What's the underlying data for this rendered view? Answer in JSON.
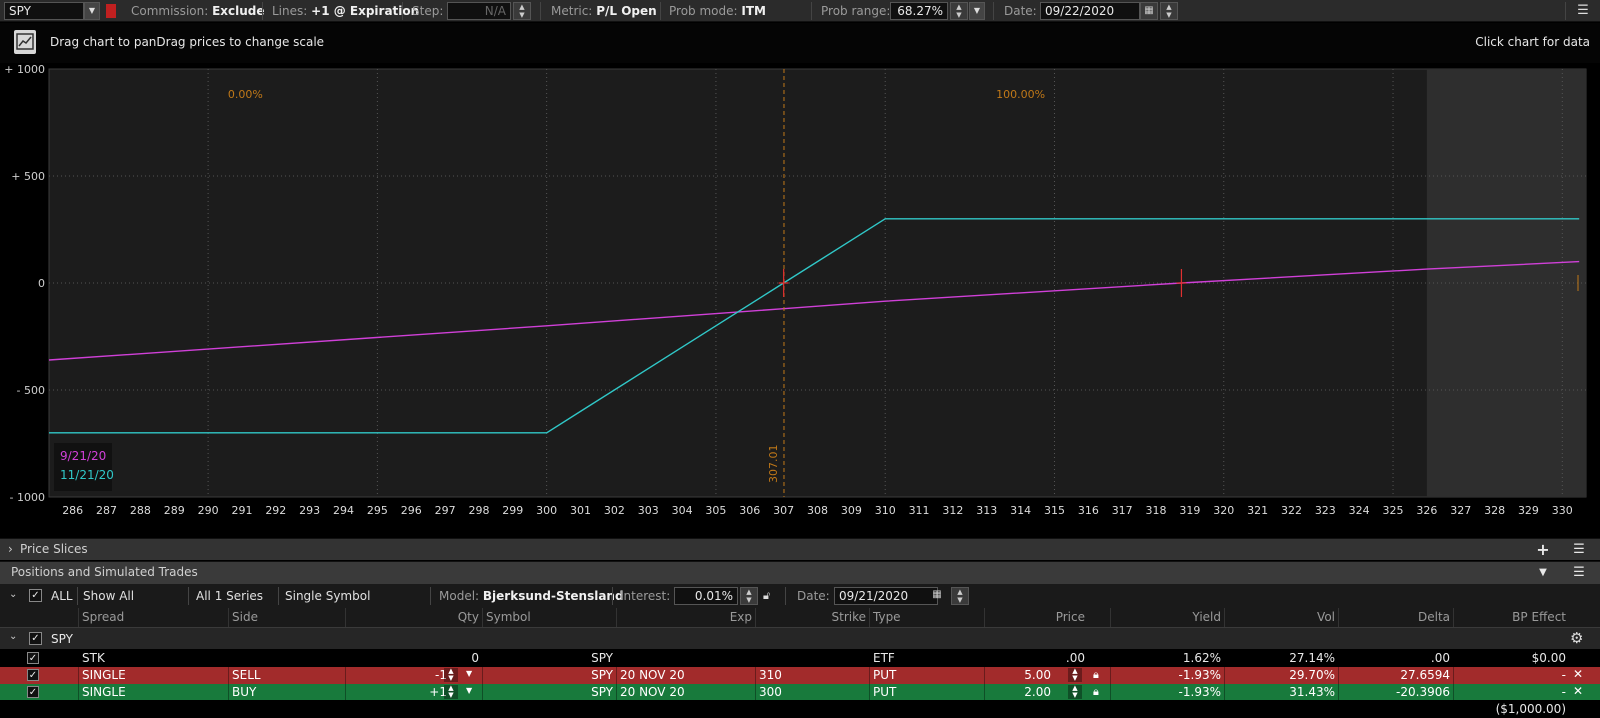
{
  "toolbar": {
    "symbol": "SPY",
    "commission_label": "Commission:",
    "commission_value": "Exclude",
    "lines_label": "Lines:",
    "lines_value": "+1 @ Expiration",
    "step_label": "Step:",
    "step_value": "N/A",
    "metric_label": "Metric:",
    "metric_value": "P/L Open",
    "prob_mode_label": "Prob mode:",
    "prob_mode_value": "ITM",
    "prob_range_label": "Prob range:",
    "prob_range_value": "68.27%",
    "date_label": "Date:",
    "date_value": "09/22/2020"
  },
  "infobar": {
    "hint": "Drag chart to panDrag prices to change scale",
    "click_hint": "Click chart for data"
  },
  "chart_data": {
    "type": "line",
    "x_range": [
      285.3,
      330.7
    ],
    "y_range": [
      -1000,
      1000
    ],
    "y_ticks": [
      {
        "value": 1000,
        "label": "+ 1000"
      },
      {
        "value": 500,
        "label": "+ 500"
      },
      {
        "value": 0,
        "label": "0"
      },
      {
        "value": -500,
        "label": "- 500"
      },
      {
        "value": -1000,
        "label": "- 1000"
      }
    ],
    "x_ticks": [
      286,
      287,
      288,
      289,
      290,
      291,
      292,
      293,
      294,
      295,
      296,
      297,
      298,
      299,
      300,
      301,
      302,
      303,
      304,
      305,
      306,
      307,
      308,
      309,
      310,
      311,
      312,
      313,
      314,
      315,
      316,
      317,
      318,
      319,
      320,
      321,
      322,
      323,
      324,
      325,
      326,
      327,
      328,
      329,
      330
    ],
    "major_x_gridlines": [
      290,
      295,
      300,
      305,
      310,
      315,
      320,
      325,
      330
    ],
    "current_price": 307.01,
    "current_price_label": "307.01",
    "shaded_from_x": 326.0,
    "prob_labels": [
      {
        "x": 291.1,
        "text": "0.00%"
      },
      {
        "x": 314.0,
        "text": "100.00%"
      }
    ],
    "breakeven_markers": [
      {
        "x": 307.0,
        "y": 0
      },
      {
        "x": 318.75,
        "y": 0
      }
    ],
    "series": [
      {
        "name": "9/21/20",
        "color": "#d040d8",
        "points": [
          [
            285.3,
            -360
          ],
          [
            300,
            -200
          ],
          [
            307,
            -120
          ],
          [
            310,
            -85
          ],
          [
            318.75,
            0
          ],
          [
            326,
            65
          ],
          [
            330.5,
            100
          ]
        ]
      },
      {
        "name": "11/21/20",
        "color": "#30c8c8",
        "points": [
          [
            285.3,
            -700
          ],
          [
            300,
            -700
          ],
          [
            301,
            -600
          ],
          [
            305,
            -200
          ],
          [
            307,
            0
          ],
          [
            309,
            200
          ],
          [
            310,
            300
          ],
          [
            330.5,
            300
          ]
        ]
      }
    ]
  },
  "sections": {
    "price_slices": "Price Slices",
    "positions": "Positions and Simulated Trades"
  },
  "filter": {
    "all_label": "ALL",
    "show_all": "Show All",
    "series": "All 1 Series",
    "single_symbol": "Single Symbol",
    "model_label": "Model:",
    "model_value": "Bjerksund-Stensland",
    "interest_label": "Interest:",
    "interest_value": "0.01%",
    "date_label": "Date:",
    "date_value": "09/21/2020"
  },
  "table": {
    "headers": {
      "spread": "Spread",
      "side": "Side",
      "qty": "Qty",
      "symbol": "Symbol",
      "exp": "Exp",
      "strike": "Strike",
      "type": "Type",
      "price": "Price",
      "yield": "Yield",
      "vol": "Vol",
      "delta": "Delta",
      "bp_effect": "BP Effect"
    },
    "group": "SPY",
    "rows": [
      {
        "spread": "STK",
        "side": "",
        "qty": "0",
        "symbol": "SPY",
        "exp": "",
        "strike": "",
        "type": "ETF",
        "price": ".00",
        "yield": "1.62%",
        "vol": "27.14%",
        "delta": ".00",
        "bp": "$0.00"
      },
      {
        "spread": "SINGLE",
        "side": "SELL",
        "qty": "-1",
        "symbol": "SPY",
        "exp": "20 NOV 20",
        "strike": "310",
        "type": "PUT",
        "price": "5.00",
        "yield": "-1.93%",
        "vol": "29.70%",
        "delta": "27.6594",
        "bp": "-"
      },
      {
        "spread": "SINGLE",
        "side": "BUY",
        "qty": "+1",
        "symbol": "SPY",
        "exp": "20 NOV 20",
        "strike": "300",
        "type": "PUT",
        "price": "2.00",
        "yield": "-1.93%",
        "vol": "31.43%",
        "delta": "-20.3906",
        "bp": "-"
      }
    ],
    "total_bp": "($1,000.00)"
  },
  "colors": {
    "sell_row": "#a22b2b",
    "buy_row": "#187a3c",
    "price_line": "#c07818"
  }
}
